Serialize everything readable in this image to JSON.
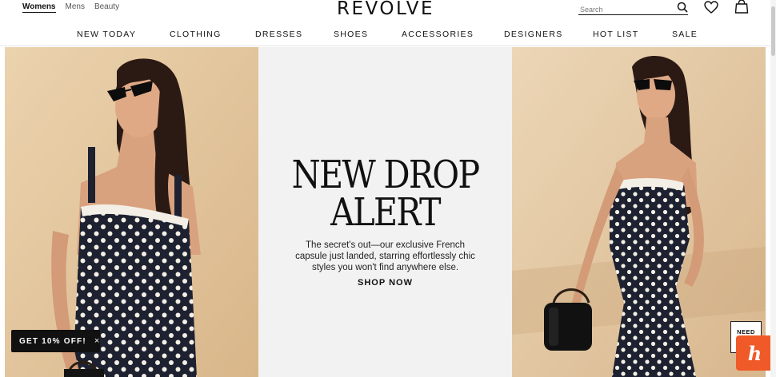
{
  "header": {
    "audience_tabs": [
      {
        "label": "Womens",
        "active": true
      },
      {
        "label": "Mens",
        "active": false
      },
      {
        "label": "Beauty",
        "active": false
      }
    ],
    "logo": "REVOLVE",
    "search": {
      "placeholder": "Search",
      "value": ""
    },
    "icons": [
      "search-icon",
      "heart-icon",
      "bag-icon"
    ]
  },
  "nav": {
    "items": [
      "NEW TODAY",
      "CLOTHING",
      "DRESSES",
      "SHOES",
      "ACCESSORIES",
      "DESIGNERS",
      "HOT LIST",
      "SALE"
    ]
  },
  "hero": {
    "headline_line1": "NEW DROP",
    "headline_line2": "ALERT",
    "blurb": "The secret's out—our exclusive French capsule just landed, starring effortlessly chic styles you won't find anywhere else.",
    "cta": "SHOP NOW",
    "left_image": "model-polka-dot-dress-sunglasses",
    "right_image": "model-polka-dot-dress-handbag"
  },
  "overlays": {
    "promo_label": "GET 10% OFF!",
    "promo_close": "×",
    "help_label": "NEED",
    "honey_label": "h"
  },
  "colors": {
    "text": "#111111",
    "hero_bg": "#f2f2f2",
    "beige_wall": "#e6cca6",
    "dress": "#1d2130",
    "honey": "#ef5a28"
  }
}
